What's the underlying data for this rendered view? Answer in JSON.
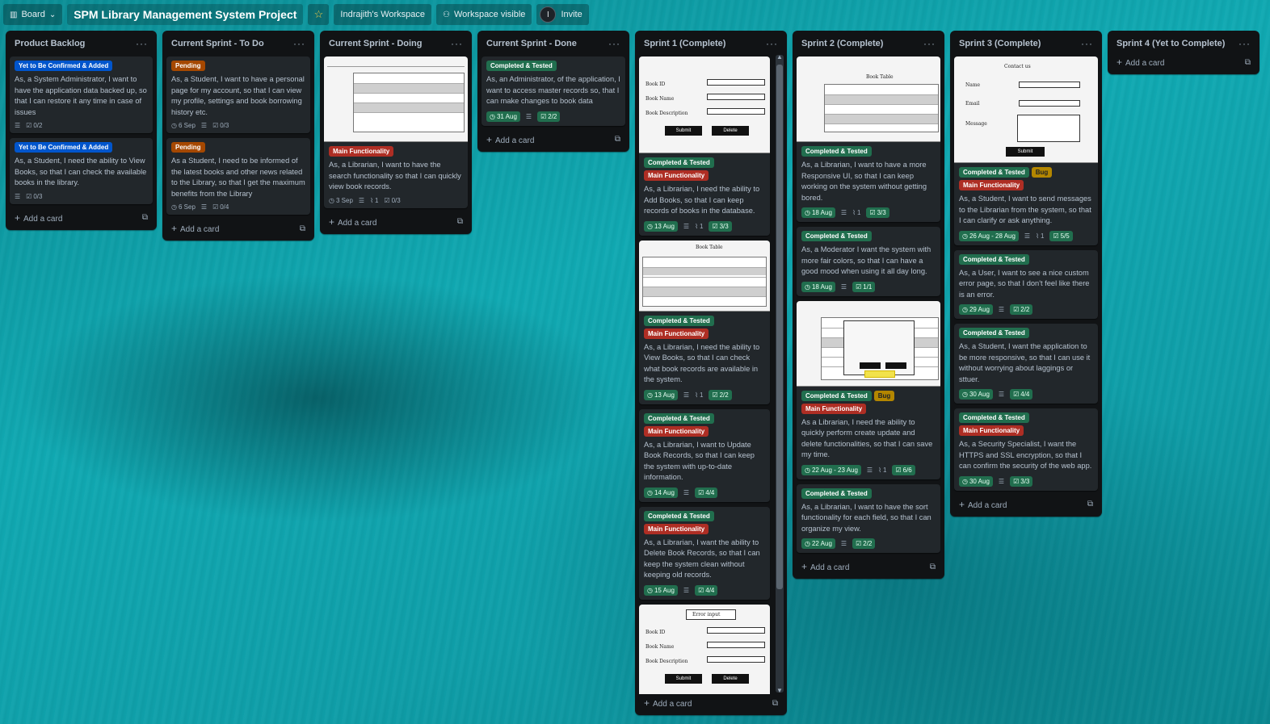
{
  "header": {
    "view_label": "Board",
    "title": "SPM Library Management System Project",
    "workspace": "Indrajith's Workspace",
    "visibility": "Workspace visible",
    "avatar_initial": "I",
    "invite": "Invite"
  },
  "common": {
    "add_card": "Add a card"
  },
  "lists": {
    "backlog": {
      "title": "Product Backlog",
      "cards": [
        {
          "label": "Yet to Be Confirmed & Added",
          "text": "As, a System Administrator, I want to have the application data backed up, so that I can restore it any time in case of issues",
          "checklist": "0/2"
        },
        {
          "label": "Yet to Be Confirmed & Added",
          "text": "As, a Student, I need the ability to View Books, so that I can check the available books in the library.",
          "checklist": "0/3"
        }
      ]
    },
    "todo": {
      "title": "Current Sprint - To Do",
      "cards": [
        {
          "label": "Pending",
          "text": "As, a Student, I want to have a personal page for my account, so that I can view my profile, settings and book borrowing history etc.",
          "date": "6 Sep",
          "checklist": "0/3"
        },
        {
          "label": "Pending",
          "text": "As a Student, I need to be informed of the latest books and other news related to the Library, so that I get the maximum benefits from the Library",
          "date": "6 Sep",
          "checklist": "0/4"
        }
      ]
    },
    "doing": {
      "title": "Current Sprint - Doing",
      "cards": [
        {
          "label": "Main Functionality",
          "text": "As, a Librarian, I want to have the search functionality so that I can quickly view book records.",
          "date": "3 Sep",
          "attachments": "1",
          "checklist": "0/3"
        }
      ]
    },
    "done": {
      "title": "Current Sprint - Done",
      "cards": [
        {
          "label": "Completed & Tested",
          "text": "As, an Administrator, of the application, I want to access master records so, that I can make changes to book data",
          "date": "31 Aug",
          "checklist": "2/2"
        }
      ]
    },
    "sprint1": {
      "title": "Sprint 1 (Complete)",
      "cards": [
        {
          "labels": [
            "Completed & Tested",
            "Main Functionality"
          ],
          "text": "As, a Librarian, I need the ability to Add Books, so that I can keep records of books in the database.",
          "date": "13 Aug",
          "attachments": "1",
          "checklist": "3/3"
        },
        {
          "labels": [
            "Completed & Tested",
            "Main Functionality"
          ],
          "text": "As, a Librarian, I need the ability to View Books, so that I can check what book records are available in the system.",
          "date": "13 Aug",
          "attachments": "1",
          "checklist": "2/2"
        },
        {
          "labels": [
            "Completed & Tested",
            "Main Functionality"
          ],
          "text": "As, a Librarian, I want to Update Book Records, so that I can keep the system with up-to-date information.",
          "date": "14 Aug",
          "checklist": "4/4"
        },
        {
          "labels": [
            "Completed & Tested",
            "Main Functionality"
          ],
          "text": "As, a Librarian, I want the ability to Delete Book Records, so that I can keep the system clean without keeping old records.",
          "date": "15 Aug",
          "checklist": "4/4"
        }
      ],
      "mock1": {
        "f1": "Book ID",
        "f2": "Book Name",
        "f3": "Book Description",
        "input": "input",
        "submit": "Submit",
        "delete": "Delete"
      },
      "mock2": {
        "title": "Book Table"
      },
      "mock3": {
        "err": "Error input",
        "f1": "Book ID",
        "f2": "Book Name",
        "f3": "Book Description",
        "input": "input",
        "submit": "Submit",
        "delete": "Delete"
      }
    },
    "sprint2": {
      "title": "Sprint 2 (Complete)",
      "cards": [
        {
          "labels": [
            "Completed & Tested"
          ],
          "text": "As, a Librarian, I want to have a more Responsive UI, so that I can keep working on the system without getting bored.",
          "date": "18 Aug",
          "attachments": "1",
          "checklist": "3/3"
        },
        {
          "labels": [
            "Completed & Tested"
          ],
          "text": "As, a Moderator I want the system with more fair colors, so that I can have a good mood when using it all day long.",
          "date": "18 Aug",
          "checklist": "1/1"
        },
        {
          "labels": [
            "Completed & Tested",
            "Bug",
            "Main Functionality"
          ],
          "text": "As a Librarian, I need the ability to quickly perform create update and delete functionalities, so that I can save my time.",
          "date": "22 Aug - 23 Aug",
          "attachments": "1",
          "checklist": "6/6"
        },
        {
          "labels": [
            "Completed & Tested"
          ],
          "text": "As, a Librarian, I want to have the sort functionality for each field, so that I can organize my view.",
          "date": "22 Aug",
          "checklist": "2/2"
        }
      ],
      "mock_title": "Book Table"
    },
    "sprint3": {
      "title": "Sprint 3 (Complete)",
      "cards": [
        {
          "labels": [
            "Completed & Tested",
            "Bug",
            "Main Functionality"
          ],
          "text": "As, a Student, I want to send messages to the Librarian from the system, so that I can clarify or ask anything.",
          "date": "26 Aug - 28 Aug",
          "attachments": "1",
          "checklist": "5/5"
        },
        {
          "labels": [
            "Completed & Tested"
          ],
          "text": "As, a User, I want to see a nice custom error page, so that I don't feel like there is an error.",
          "date": "29 Aug",
          "checklist": "2/2"
        },
        {
          "labels": [
            "Completed & Tested"
          ],
          "text": "As, a Student, I want the application to be more responsive, so that I can use it without worrying about laggings or sttuer.",
          "date": "30 Aug",
          "checklist": "4/4"
        },
        {
          "labels": [
            "Completed & Tested",
            "Main Functionality"
          ],
          "text": "As, a Security Specialist, I want the HTTPS and SSL encryption, so that I can confirm the security of the web app.",
          "date": "30 Aug",
          "checklist": "3/3"
        }
      ],
      "mock": {
        "title": "Contact us",
        "name": "Name",
        "email": "Email",
        "message": "Message",
        "input": "input",
        "submit": "Submit"
      }
    },
    "sprint4": {
      "title": "Sprint 4 (Yet to Complete)"
    }
  },
  "colors": {
    "green": "#216e4e",
    "red": "#ae2e24",
    "blue": "#0055cc",
    "orange": "#a54800",
    "yellow": "#b38600",
    "list_bg": "#111315",
    "card_bg": "#22272b"
  }
}
